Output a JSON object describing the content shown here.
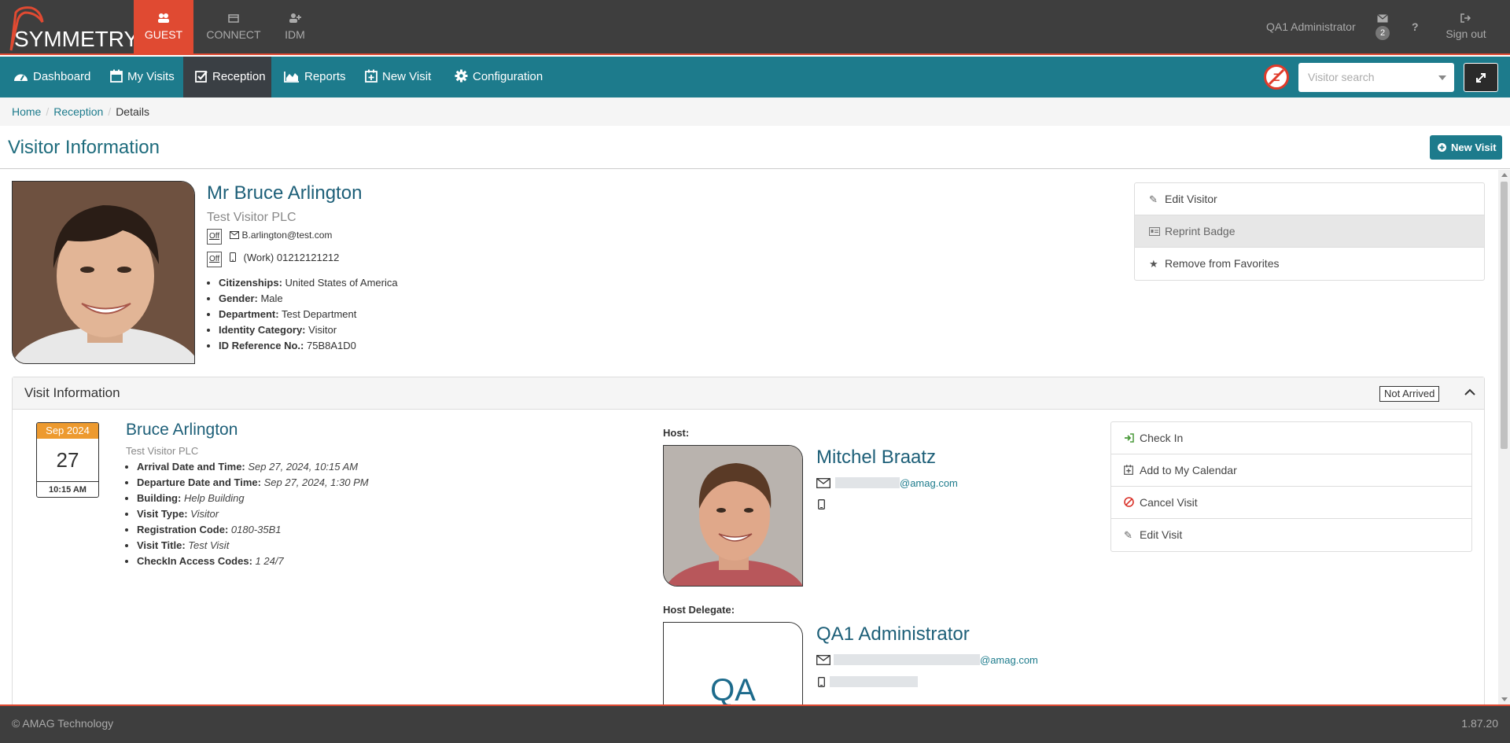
{
  "brand": {
    "name": "SYMMETRY",
    "tm": "™",
    "accent": "#e04a32",
    "nav_color": "#1d7b8c"
  },
  "apps": [
    {
      "label": "GUEST",
      "icon": "users-icon",
      "active": true
    },
    {
      "label": "CONNECT",
      "icon": "card-icon"
    },
    {
      "label": "IDM",
      "icon": "user-plus-icon"
    }
  ],
  "user": {
    "name": "QA1 Administrator",
    "mail_count": "2",
    "help": "?",
    "signout": "Sign out"
  },
  "nav": [
    {
      "label": "Dashboard",
      "icon": "dashboard-icon"
    },
    {
      "label": "My Visits",
      "icon": "calendar-icon"
    },
    {
      "label": "Reception",
      "icon": "checkbox-icon",
      "active": true
    },
    {
      "label": "Reports",
      "icon": "area-chart-icon"
    },
    {
      "label": "New Visit",
      "icon": "calendar-plus-icon"
    },
    {
      "label": "Configuration",
      "icon": "gear-icon"
    }
  ],
  "search": {
    "placeholder": "Visitor search"
  },
  "breadcrumb": {
    "home": "Home",
    "reception": "Reception",
    "current": "Details",
    "sep": "/"
  },
  "page": {
    "title": "Visitor Information",
    "new_visit": "New Visit"
  },
  "visitor": {
    "name": "Mr Bruce Arlington",
    "company": "Test Visitor PLC",
    "email_pref": "Off",
    "email": "B.arlington@test.com",
    "phone_pref": "Off",
    "phone": "(Work) 01212121212",
    "attributes": [
      {
        "key": "Citizenships:",
        "value": "United States of America"
      },
      {
        "key": "Gender:",
        "value": "Male"
      },
      {
        "key": "Department:",
        "value": "Test Department"
      },
      {
        "key": "Identity Category:",
        "value": "Visitor"
      },
      {
        "key": "ID Reference No.:",
        "value": "75B8A1D0"
      }
    ]
  },
  "visitor_actions": [
    {
      "label": "Edit Visitor",
      "icon": "edit-icon"
    },
    {
      "label": "Reprint Badge",
      "icon": "badge-icon",
      "active": true
    },
    {
      "label": "Remove from Favorites",
      "icon": "star-icon"
    }
  ],
  "visit": {
    "header": "Visit Information",
    "status": "Not Arrived",
    "cal_month": "Sep 2024",
    "cal_day": "27",
    "cal_time": "10:15 AM",
    "name": "Bruce Arlington",
    "company": "Test Visitor PLC",
    "details": [
      {
        "key": "Arrival Date and Time:",
        "value": "Sep 27, 2024, 10:15 AM"
      },
      {
        "key": "Departure Date and Time:",
        "value": "Sep 27, 2024, 1:30 PM"
      },
      {
        "key": "Building:",
        "value": "Help Building"
      },
      {
        "key": "Visit Type:",
        "value": "Visitor"
      },
      {
        "key": "Registration Code:",
        "value": "0180-35B1"
      },
      {
        "key": "Visit Title:",
        "value": "Test Visit"
      },
      {
        "key": "CheckIn Access Codes:",
        "value": "1 24/7"
      }
    ],
    "host_label": "Host:",
    "host_name": "Mitchel Braatz",
    "host_email_domain": "@amag.com",
    "delegate_label": "Host Delegate:",
    "delegate_initials": "QA",
    "delegate_name": "QA1 Administrator",
    "delegate_email_domain": "@amag.com"
  },
  "visit_actions": [
    {
      "label": "Check In",
      "icon": "sign-in-icon"
    },
    {
      "label": "Add to My Calendar",
      "icon": "calendar-plus-icon"
    },
    {
      "label": "Cancel Visit",
      "icon": "ban-icon"
    },
    {
      "label": "Edit Visit",
      "icon": "edit-icon"
    }
  ],
  "footer": {
    "copyright": "© AMAG Technology",
    "version": "1.87.20"
  }
}
